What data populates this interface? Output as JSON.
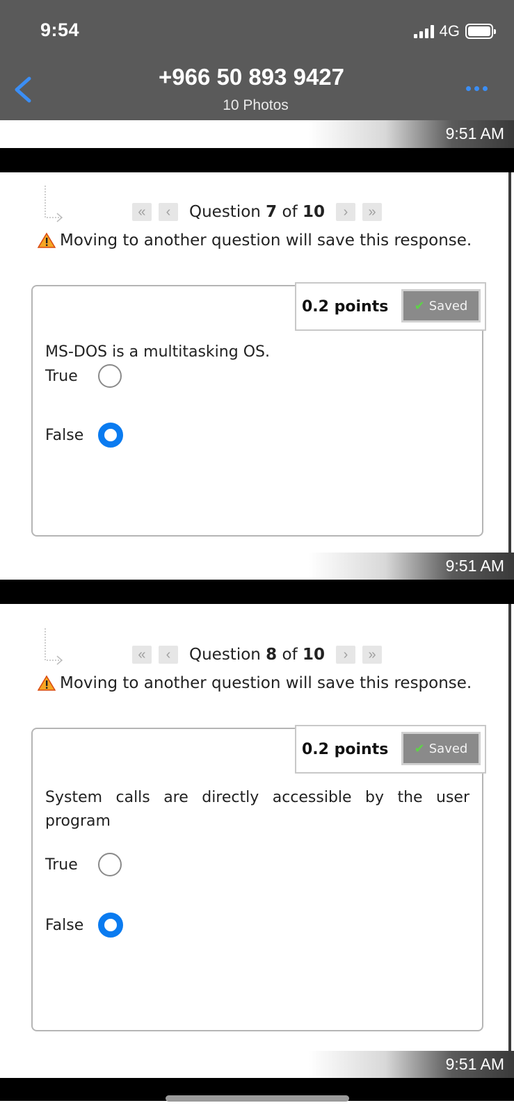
{
  "status_bar": {
    "time": "9:54",
    "network": "4G"
  },
  "header": {
    "title": "+966 50 893 9427",
    "subtitle": "10 Photos"
  },
  "timestamps": [
    "9:51 AM",
    "9:51 AM",
    "9:51 AM"
  ],
  "questions": [
    {
      "nav_prefix": "Question ",
      "number": "7",
      "nav_of": " of ",
      "total": "10",
      "warning": "Moving to another question will save this response.",
      "points": "0.2 points",
      "saved": "Saved",
      "text": "MS-DOS is a multitasking OS.",
      "options": [
        {
          "label": "True",
          "selected": false
        },
        {
          "label": "False",
          "selected": true
        }
      ]
    },
    {
      "nav_prefix": "Question ",
      "number": "8",
      "nav_of": " of ",
      "total": "10",
      "warning": "Moving to another question will save this response.",
      "points": "0.2 points",
      "saved": "Saved",
      "text": "System calls are directly accessible by the user program",
      "options": [
        {
          "label": "True",
          "selected": false
        },
        {
          "label": "False",
          "selected": true
        }
      ]
    }
  ],
  "colors": {
    "header_bg": "#5a5a5a",
    "accent": "#3b8ef5",
    "radio_selected": "#0a7bf0"
  },
  "icons": [
    "back-chevron-icon",
    "more-dots-icon",
    "signal-icon",
    "battery-icon",
    "warning-icon",
    "check-icon"
  ]
}
